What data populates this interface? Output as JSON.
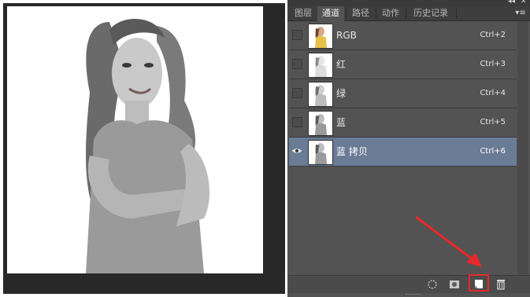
{
  "panel": {
    "tabs": [
      {
        "label": "图层",
        "active": false
      },
      {
        "label": "通道",
        "active": true
      },
      {
        "label": "路径",
        "active": false
      },
      {
        "label": "动作",
        "active": false
      },
      {
        "label": "历史记录",
        "active": false
      }
    ]
  },
  "channels": [
    {
      "name": "RGB",
      "shortcut": "Ctrl+2",
      "visible": false,
      "selected": false,
      "color_thumb": true
    },
    {
      "name": "红",
      "shortcut": "Ctrl+3",
      "visible": false,
      "selected": false,
      "color_thumb": false
    },
    {
      "name": "绿",
      "shortcut": "Ctrl+4",
      "visible": false,
      "selected": false,
      "color_thumb": false
    },
    {
      "name": "蓝",
      "shortcut": "Ctrl+5",
      "visible": false,
      "selected": false,
      "color_thumb": false
    },
    {
      "name": "蓝 拷贝",
      "shortcut": "Ctrl+6",
      "visible": true,
      "selected": true,
      "color_thumb": false
    }
  ],
  "bottom_tools": [
    "load-selection-icon",
    "save-selection-icon",
    "new-channel-icon",
    "delete-icon"
  ],
  "colors": {
    "panel_bg": "#535353",
    "selected_row": "#6a7b95",
    "highlight": "#e8282d",
    "workspace_bg": "#282828"
  }
}
